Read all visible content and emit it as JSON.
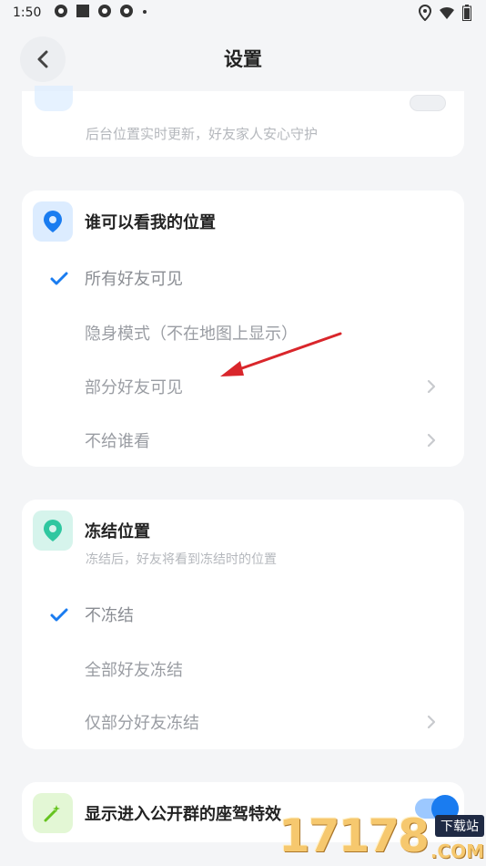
{
  "status_bar": {
    "time": "1:50"
  },
  "header": {
    "title": "设置"
  },
  "card_top": {
    "subtitle": "后台位置实时更新，好友家人安心守护"
  },
  "visibility": {
    "title": "谁可以看我的位置",
    "options": [
      {
        "label": "所有好友可见",
        "selected": true,
        "has_chevron": false
      },
      {
        "label": "隐身模式（不在地图上显示）",
        "selected": false,
        "has_chevron": false
      },
      {
        "label": "部分好友可见",
        "selected": false,
        "has_chevron": true
      },
      {
        "label": "不给谁看",
        "selected": false,
        "has_chevron": true
      }
    ]
  },
  "freeze": {
    "title": "冻结位置",
    "description": "冻结后，好友将看到冻结时的位置",
    "options": [
      {
        "label": "不冻结",
        "selected": true,
        "has_chevron": false
      },
      {
        "label": "全部好友冻结",
        "selected": false,
        "has_chevron": false
      },
      {
        "label": "仅部分好友冻结",
        "selected": false,
        "has_chevron": true
      }
    ]
  },
  "effect": {
    "title": "显示进入公开群的座驾特效",
    "enabled": true
  },
  "watermark": {
    "number": "17178",
    "badge": "下载站",
    "suffix": ".COM"
  },
  "colors": {
    "accent": "#1a7cf0",
    "check": "#1a7cf0",
    "arrow": "#d9262b"
  }
}
